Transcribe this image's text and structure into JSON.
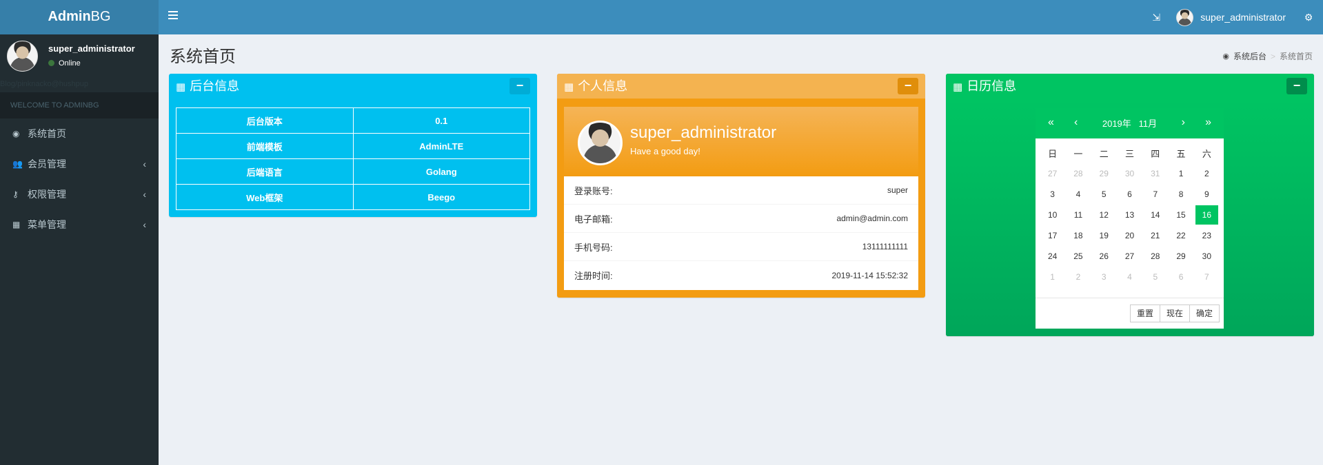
{
  "app": {
    "logo_bold": "Admin",
    "logo_rest": "BG"
  },
  "navbar": {
    "user_name": "super_administrator"
  },
  "sidebar": {
    "user_name": "super_administrator",
    "status": "Online",
    "ghost_text": "Blog/pinknacko@hushpup",
    "header": "WELCOME TO ADMINBG",
    "items": [
      {
        "label": "系统首页",
        "icon": "dashboard-icon",
        "has_children": false
      },
      {
        "label": "会员管理",
        "icon": "users-icon",
        "has_children": true
      },
      {
        "label": "权限管理",
        "icon": "key-icon",
        "has_children": true
      },
      {
        "label": "菜单管理",
        "icon": "grid-icon",
        "has_children": true
      }
    ]
  },
  "page": {
    "title": "系统首页",
    "breadcrumb": [
      "系统后台",
      "系统首页"
    ]
  },
  "backend_box": {
    "title": "后台信息",
    "rows": [
      [
        "后台版本",
        "0.1"
      ],
      [
        "前端模板",
        "AdminLTE"
      ],
      [
        "后端语言",
        "Golang"
      ],
      [
        "Web框架",
        "Beego"
      ]
    ]
  },
  "profile_box": {
    "title": "个人信息",
    "name": "super_administrator",
    "tagline": "Have a good day!",
    "rows": [
      {
        "label": "登录账号:",
        "value": "super"
      },
      {
        "label": "电子邮箱:",
        "value": "admin@admin.com"
      },
      {
        "label": "手机号码:",
        "value": "13111111111"
      },
      {
        "label": "注册时间:",
        "value": "2019-11-14 15:52:32"
      }
    ]
  },
  "calendar_box": {
    "title": "日历信息",
    "year_label": "2019年",
    "month_label": "11月",
    "weekdays": [
      "日",
      "一",
      "二",
      "三",
      "四",
      "五",
      "六"
    ],
    "weeks": [
      [
        "27",
        "28",
        "29",
        "30",
        "31",
        "1",
        "2"
      ],
      [
        "3",
        "4",
        "5",
        "6",
        "7",
        "8",
        "9"
      ],
      [
        "10",
        "11",
        "12",
        "13",
        "14",
        "15",
        "16"
      ],
      [
        "17",
        "18",
        "19",
        "20",
        "21",
        "22",
        "23"
      ],
      [
        "24",
        "25",
        "26",
        "27",
        "28",
        "29",
        "30"
      ],
      [
        "1",
        "2",
        "3",
        "4",
        "5",
        "6",
        "7"
      ]
    ],
    "selected_day": "16",
    "buttons": [
      "重置",
      "现在",
      "确定"
    ]
  },
  "colors": {
    "navbar": "#3c8dbc",
    "sidebar": "#222d32",
    "aqua": "#00c0ef",
    "yellow": "#f39c12",
    "green": "#00a65a"
  }
}
